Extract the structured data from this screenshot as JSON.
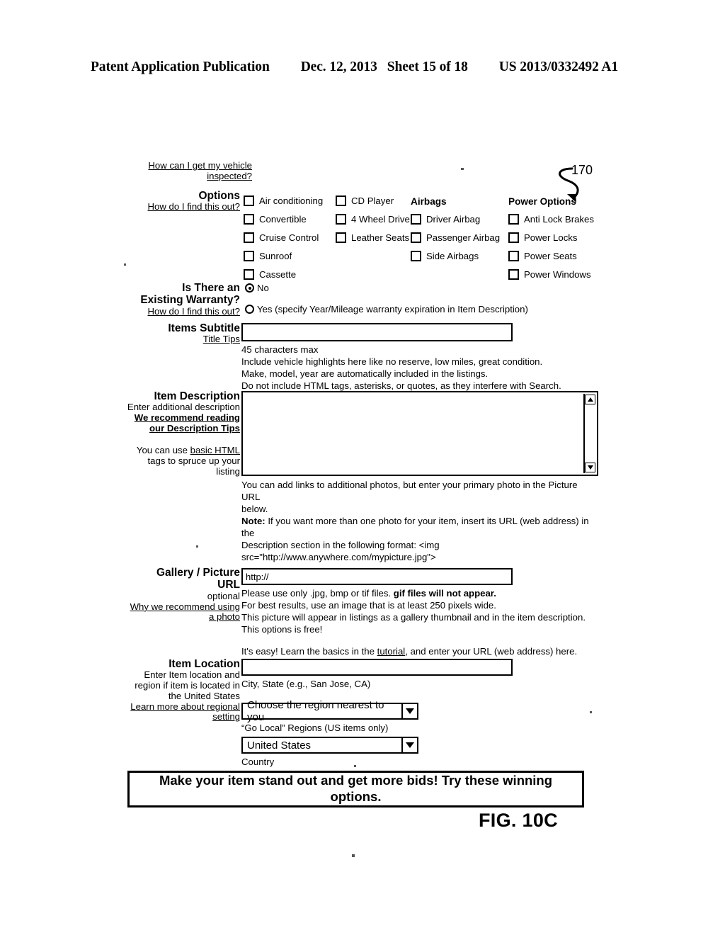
{
  "header": {
    "publication": "Patent Application Publication",
    "date": "Dec. 12, 2013",
    "sheet": "Sheet 15 of 18",
    "patent_number": "US 2013/0332492 A1"
  },
  "figure": {
    "label": "FIG. 10C",
    "reference_numeral": "170"
  },
  "inspect_link": {
    "line1": "How can I get my vehicle",
    "line2": "inspected?"
  },
  "options": {
    "label": "Options",
    "help_link": "How do I find this out?",
    "column1": [
      "Air conditioning",
      "Convertible",
      "Cruise Control",
      "Sunroof",
      "Cassette"
    ],
    "column2": [
      "CD Player",
      "4 Wheel Drive",
      "Leather Seats"
    ],
    "airbags": {
      "heading": "Airbags",
      "items": [
        "Driver Airbag",
        "Passenger Airbag",
        "Side Airbags"
      ]
    },
    "power_options": {
      "heading": "Power Options",
      "items": [
        "Anti Lock Brakes",
        "Power Locks",
        "Power Seats",
        "Power Windows"
      ]
    }
  },
  "warranty": {
    "label_line1": "Is There an",
    "label_line2": "Existing Warranty?",
    "help_link": "How do I find this out?",
    "option_no": "No",
    "option_yes": "Yes (specify Year/Mileage warranty expiration in Item Description)",
    "selected": "No"
  },
  "subtitle": {
    "label": "Items Subtitle",
    "tips_link": "Title Tips",
    "value": "",
    "hint_line1": "45 characters max",
    "hint_line2": "Include vehicle highlights here like no reserve, low miles, great condition.",
    "hint_line3": "Make, model, year are automatically included in the listings.",
    "hint_line4": "Do not include HTML tags, asterisks, or quotes, as they interfere with Search."
  },
  "description": {
    "label": "Item Description",
    "sub_line1": "Enter additional description",
    "link_line1": "We recommend reading",
    "link_line2": "our Description Tips",
    "html_line1_pre": "You can use ",
    "html_line1_link": "basic HTML",
    "html_line2": "tags to spruce up your",
    "html_line3": "listing",
    "value": "",
    "below_line1": "You can add links to additional photos, but enter your primary photo in the Picture URL",
    "below_line2": "below.",
    "note_label": "Note:",
    "note_line1": " If you want more than one photo for your item, insert its URL (web address) in the",
    "note_line2": "Description section in the following format: <img",
    "note_line3": "src=\"http://www.anywhere.com/mypicture.jpg\">"
  },
  "gallery": {
    "label_line1": "Gallery / Picture",
    "label_line2": "URL",
    "label_line3": "optional",
    "link_line1": "Why we recommend using",
    "link_line2": "a photo",
    "value": "http://",
    "hint_line1_pre": "Please use only .jpg, bmp or tif files. ",
    "hint_line1_bold": "gif files will not appear.",
    "hint_line2": "For best results, use an image that is at least 250 pixels wide.",
    "hint_line3": "This picture will appear in listings as a gallery thumbnail and in the item description.",
    "hint_line4": "This options is free!",
    "easy_pre": "It's easy!  Learn the basics in the ",
    "easy_link": "tutorial",
    "easy_post": ", and enter your URL (web address) here."
  },
  "location": {
    "label": "Item Location",
    "sub_line1": "Enter Item location and",
    "sub_line2": "region if item is located in",
    "sub_line3": "the United States",
    "link_line1": "Learn more about regional",
    "link_line2": "setting",
    "value": "",
    "hint": "City, State (e.g., San Jose, CA)",
    "region_selected": "Choose the region nearest to you",
    "region_hint": "“Go Local” Regions (US items only)",
    "country_selected": "United States",
    "country_hint": "Country"
  },
  "promo_banner": {
    "line1": "Make your item stand out and get more bids!  Try these winning",
    "line2": "options."
  },
  "icons": {
    "checkbox": "checkbox-icon",
    "radio": "radio-icon",
    "scroll_up": "triangle-up-icon",
    "scroll_down": "triangle-down-icon",
    "dropdown": "chevron-down-icon"
  }
}
